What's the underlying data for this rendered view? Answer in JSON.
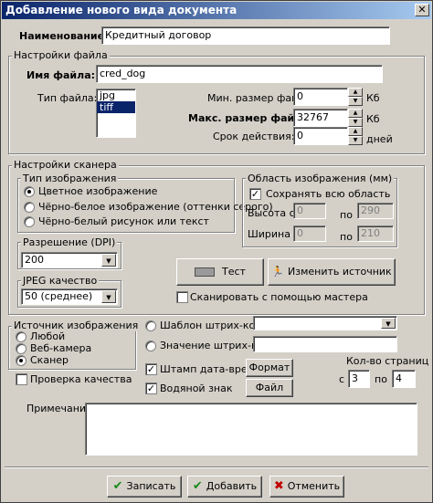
{
  "window": {
    "title": "Добавление нового вида документа",
    "close_glyph": "✕"
  },
  "name_field": {
    "label": "Наименование:",
    "value": "Кредитный договор"
  },
  "file_settings": {
    "title": "Настройки файла",
    "filename_label": "Имя файла:",
    "filename_value": "cred_dog",
    "filetype_label": "Тип файла:",
    "filetypes": [
      "jpg",
      "tiff"
    ],
    "filetype_selected": "tiff",
    "min_size_label": "Мин. размер файла:",
    "min_size_value": "0",
    "min_size_unit": "Кб",
    "max_size_label": "Макс. размер файла:",
    "max_size_value": "32767",
    "max_size_unit": "Кб",
    "validity_label": "Срок действия:",
    "validity_value": "0",
    "validity_unit": "дней"
  },
  "scanner_settings": {
    "title": "Настройки сканера",
    "image_type": {
      "title": "Тип изображения",
      "options": [
        "Цветное изображение",
        "Чёрно-белое изображение (оттенки серого)",
        "Чёрно-белый рисунок или текст"
      ],
      "selected_index": 0
    },
    "image_area": {
      "title": "Область изображения (мм)",
      "keep_all_label": "Сохранять всю область",
      "keep_all_checked": true,
      "height_label": "Высота с",
      "height_from": "0",
      "height_to_label": "по",
      "height_to": "290",
      "width_label": "Ширина с",
      "width_from": "0",
      "width_to_label": "по",
      "width_to": "210"
    },
    "resolution": {
      "title": "Разрешение (DPI)",
      "value": "200"
    },
    "jpeg_quality": {
      "title": "JPEG качество",
      "value": "50 (среднее)"
    },
    "test_button": "Тест",
    "change_source_button": "Изменить источник",
    "wizard_label": "Сканировать с помощью мастера",
    "wizard_checked": false
  },
  "image_source": {
    "title": "Источник изображения",
    "options": [
      "Любой",
      "Веб-камера",
      "Сканер"
    ],
    "selected_index": 2
  },
  "quality_check": {
    "label": "Проверка качества",
    "checked": false
  },
  "barcode": {
    "template_label": "Шаблон штрих-кода",
    "template_value": "",
    "value_label": "Значение штрих-кода",
    "value": ""
  },
  "stamp": {
    "datetime_label": "Штамп дата-время",
    "datetime_checked": true,
    "format_button": "Формат",
    "watermark_label": "Водяной знак",
    "watermark_checked": true,
    "file_button": "Файл"
  },
  "pages": {
    "title": "Кол-во страниц",
    "from_label": "с",
    "from": "3",
    "to_label": "по",
    "to": "4"
  },
  "note": {
    "label": "Примечание:",
    "value": ""
  },
  "footer": {
    "save": "Записать",
    "add": "Добавить",
    "cancel": "Отменить"
  },
  "colors": {
    "title_start": "#0a246a",
    "title_end": "#a6caf0",
    "face": "#d4d0c8",
    "selection": "#0a246a"
  },
  "icons": {
    "test": "scanner-icon",
    "change_source": "person-running-icon",
    "save": "checkmark-icon",
    "add": "checkmark-icon",
    "cancel": "cross-icon"
  }
}
